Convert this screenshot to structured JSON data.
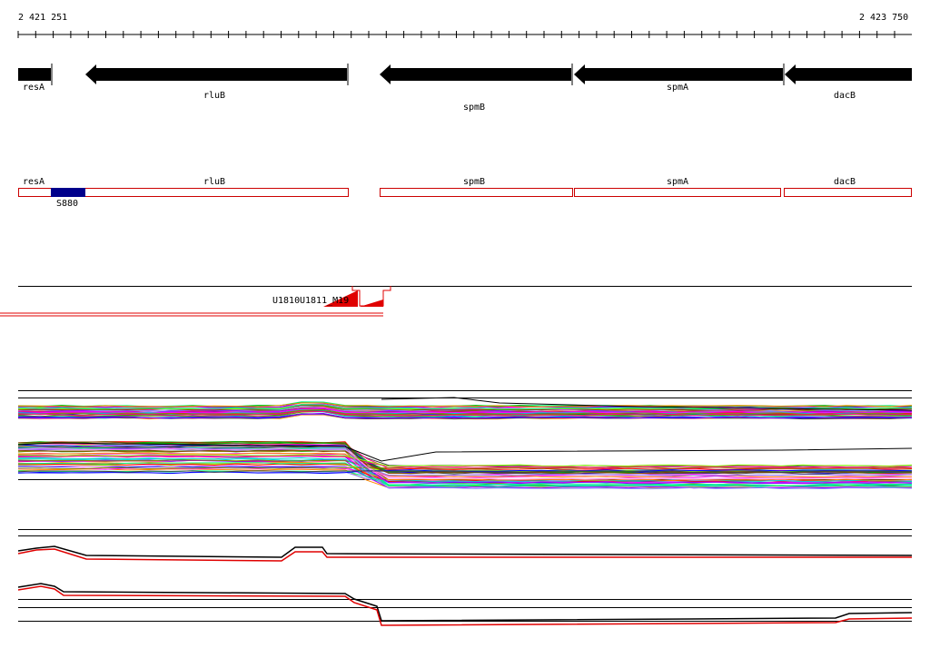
{
  "ruler": {
    "start_label": "2 421 251",
    "end_label": "2 423 750"
  },
  "genes": [
    {
      "name": "resA",
      "strand": "-"
    },
    {
      "name": "rluB",
      "strand": "-"
    },
    {
      "name": "spmB",
      "strand": "-"
    },
    {
      "name": "spmA",
      "strand": "-"
    },
    {
      "name": "dacB",
      "strand": "-"
    }
  ],
  "regions": {
    "labels": [
      "resA",
      "rluB",
      "spmB",
      "spmA",
      "dacB"
    ],
    "feature": {
      "label": "S880"
    }
  },
  "reads": {
    "label_a": "U1810",
    "label_b": "U1811_M19"
  },
  "colors": {
    "gene_arrow": "#000000",
    "region_outline": "#cc0000",
    "feature_fill": "#00008b",
    "read_line": "#e00000",
    "palette": [
      "#ff0000",
      "#00aa00",
      "#0000ff",
      "#ff00ff",
      "#00cccc",
      "#ff8800",
      "#8800ff",
      "#888800",
      "#00ff88",
      "#ff0088",
      "#8888ff",
      "#884400",
      "#88ff00",
      "#ff88ff",
      "#444444"
    ]
  }
}
